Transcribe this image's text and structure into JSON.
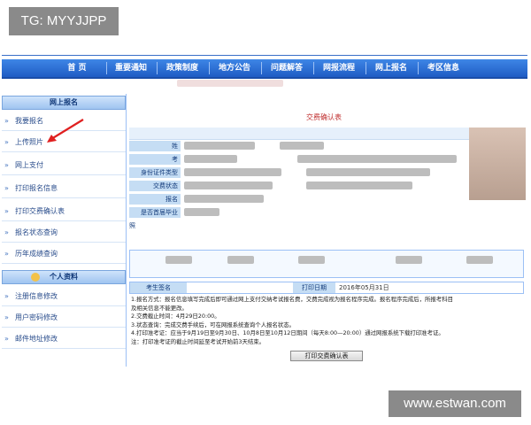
{
  "watermark_top": "TG: MYYJJPP",
  "watermark_bottom": "www.estwan.com",
  "nav": {
    "items": [
      "首 页",
      "重要通知",
      "政策制度",
      "地方公告",
      "问题解答",
      "网报流程",
      "网上报名",
      "考区信息"
    ]
  },
  "sidebar": {
    "section1": "网上报名",
    "section2": "个人资料",
    "items1": [
      "我要报名",
      "上传照片",
      "网上支付",
      "打印报名信息",
      "打印交费确认表",
      "报名状态查询",
      "历年成绩查询"
    ],
    "items2": [
      "注册信息修改",
      "用户密码修改",
      "邮件地址修改"
    ]
  },
  "main": {
    "title": "交费确认表",
    "field_labels": [
      "姓",
      "考",
      "身份证件类型",
      "交费状态",
      "报名",
      "是否首届毕业",
      "照"
    ],
    "sign_label": "考生签名",
    "print_date_label": "打印日期",
    "print_date_value": "2016年05月31日",
    "notes": [
      "1.报名方式：报名信息填写完成后即可通过网上支付交纳考试报名费，交费完成视为报名程序完成。报名程序完成后，所报考科目",
      "及相关信息不能更改。",
      "2.交费截止时间：4月29日20:00。",
      "3.状态查询：完成交费手续后，可在网报系统查询个人报名状态。",
      "4.打印准考证：应当于9月19日至9月30日、10月8日至10月12日期间（每天8:00—20:00）通过网报系统下载打印准考证。",
      "注：打印准考证的截止时间延至考试开始前3天结束。"
    ],
    "print_button": "打印交费确认表"
  }
}
